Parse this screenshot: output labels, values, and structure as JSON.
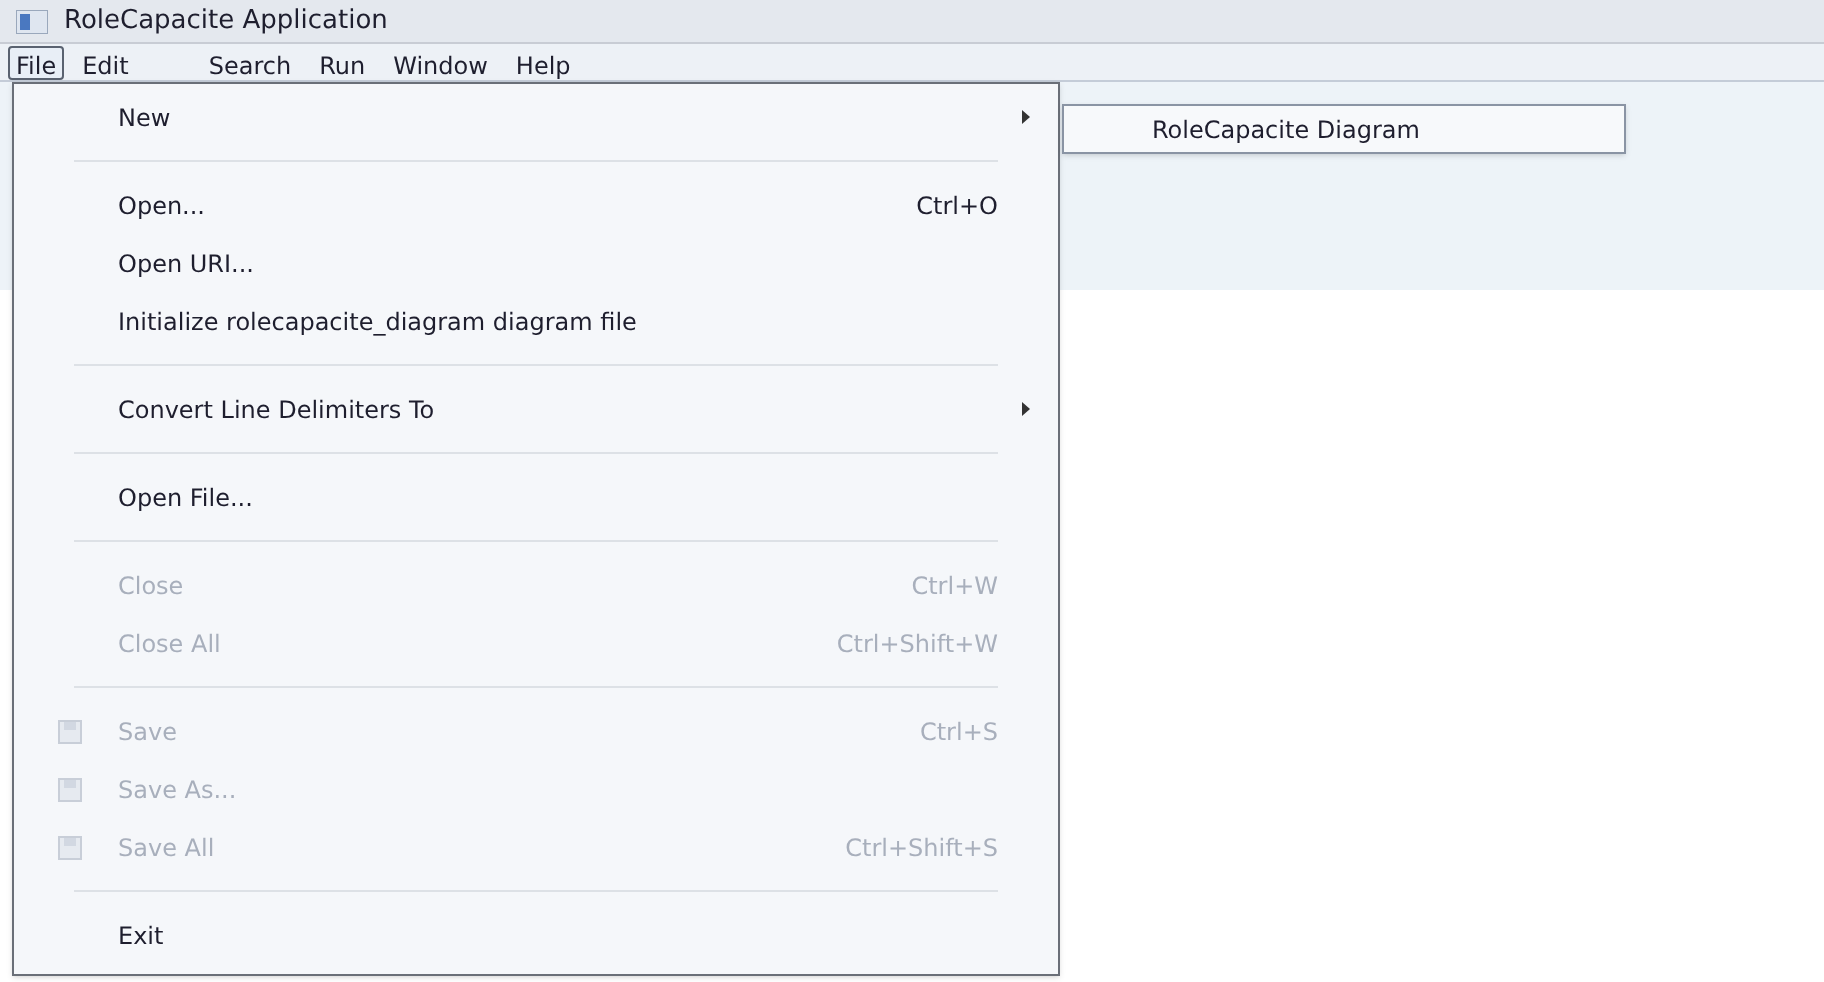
{
  "window": {
    "title": "RoleCapacite Application"
  },
  "menubar": [
    {
      "label": "File",
      "selected": true
    },
    {
      "label": "Edit",
      "selected": false
    },
    {
      "label": "Search",
      "selected": false
    },
    {
      "label": "Run",
      "selected": false
    },
    {
      "label": "Window",
      "selected": false
    },
    {
      "label": "Help",
      "selected": false
    }
  ],
  "file_menu": [
    {
      "kind": "item",
      "label": "New",
      "submenu": true,
      "disabled": false
    },
    {
      "kind": "separator"
    },
    {
      "kind": "item",
      "label": "Open...",
      "shortcut": "Ctrl+O",
      "disabled": false
    },
    {
      "kind": "item",
      "label": "Open URI...",
      "disabled": false
    },
    {
      "kind": "item",
      "label": "Initialize rolecapacite_diagram diagram file",
      "disabled": false
    },
    {
      "kind": "separator"
    },
    {
      "kind": "item",
      "label": "Convert Line Delimiters To",
      "submenu": true,
      "disabled": false
    },
    {
      "kind": "separator"
    },
    {
      "kind": "item",
      "label": "Open File...",
      "disabled": false
    },
    {
      "kind": "separator"
    },
    {
      "kind": "item",
      "label": "Close",
      "shortcut": "Ctrl+W",
      "disabled": true
    },
    {
      "kind": "item",
      "label": "Close All",
      "shortcut": "Ctrl+Shift+W",
      "disabled": true
    },
    {
      "kind": "separator"
    },
    {
      "kind": "item",
      "label": "Save",
      "shortcut": "Ctrl+S",
      "disabled": true,
      "icon": true
    },
    {
      "kind": "item",
      "label": "Save As...",
      "disabled": true,
      "icon": true
    },
    {
      "kind": "item",
      "label": "Save All",
      "shortcut": "Ctrl+Shift+S",
      "disabled": true,
      "icon": true
    },
    {
      "kind": "separator"
    },
    {
      "kind": "item",
      "label": "Exit",
      "disabled": false
    }
  ],
  "new_submenu": [
    {
      "label": "RoleCapacite Diagram"
    }
  ]
}
